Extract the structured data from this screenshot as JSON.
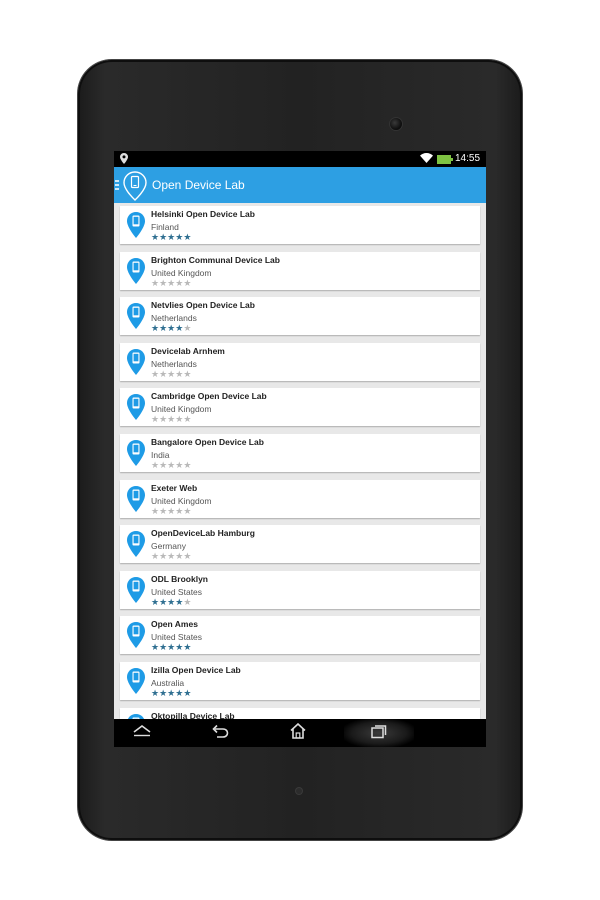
{
  "status_bar": {
    "time": "14:55"
  },
  "app_bar": {
    "title": "Open Device Lab"
  },
  "labs": [
    {
      "name": "Helsinki Open Device Lab",
      "country": "Finland",
      "rating": 5
    },
    {
      "name": "Brighton Communal Device Lab",
      "country": "United Kingdom",
      "rating": 0
    },
    {
      "name": "Netvlies Open Device Lab",
      "country": "Netherlands",
      "rating": 4
    },
    {
      "name": "Devicelab Arnhem",
      "country": "Netherlands",
      "rating": 0
    },
    {
      "name": "Cambridge Open Device Lab",
      "country": "United Kingdom",
      "rating": 0
    },
    {
      "name": "Bangalore Open Device Lab",
      "country": "India",
      "rating": 0
    },
    {
      "name": "Exeter Web",
      "country": "United Kingdom",
      "rating": 0
    },
    {
      "name": "OpenDeviceLab Hamburg",
      "country": "Germany",
      "rating": 0
    },
    {
      "name": "ODL Brooklyn",
      "country": "United States",
      "rating": 4
    },
    {
      "name": "Open Ames",
      "country": "United States",
      "rating": 5
    },
    {
      "name": "Izilla Open Device Lab",
      "country": "Australia",
      "rating": 5
    },
    {
      "name": "Oktopilla Device Lab",
      "country": "",
      "rating": 0
    }
  ],
  "colors": {
    "app_bar": "#2d9fe3",
    "pin": "#1e9be6",
    "star_on": "#2f6f91",
    "star_off": "#b9b9b9"
  },
  "icons": {
    "status": [
      "location-pin-icon",
      "wifi-icon",
      "battery-icon"
    ],
    "nav": [
      "back-chevron-icon",
      "undo-arrow-icon",
      "home-icon",
      "recent-apps-icon"
    ]
  }
}
